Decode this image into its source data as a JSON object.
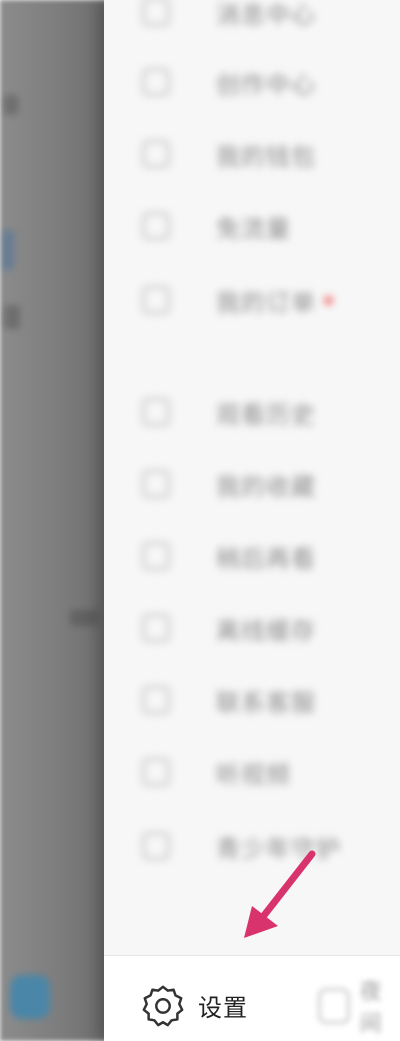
{
  "drawer": {
    "items": [
      {
        "label": "消息中心"
      },
      {
        "label": "创作中心"
      },
      {
        "label": "我的钱包"
      },
      {
        "label": "免流量",
        "badge": true
      },
      {
        "label": "我的订单"
      },
      {
        "label": "观看历史"
      },
      {
        "label": "我的收藏"
      },
      {
        "label": "稍后再看"
      },
      {
        "label": "离线缓存"
      },
      {
        "label": "联系客服"
      },
      {
        "label": "听视频"
      },
      {
        "label": "青少年守护"
      }
    ]
  },
  "bottom_bar": {
    "settings_label": "设置",
    "other_label": "夜间"
  },
  "colors": {
    "arrow": "#d8336d",
    "badge": "#f07070"
  }
}
